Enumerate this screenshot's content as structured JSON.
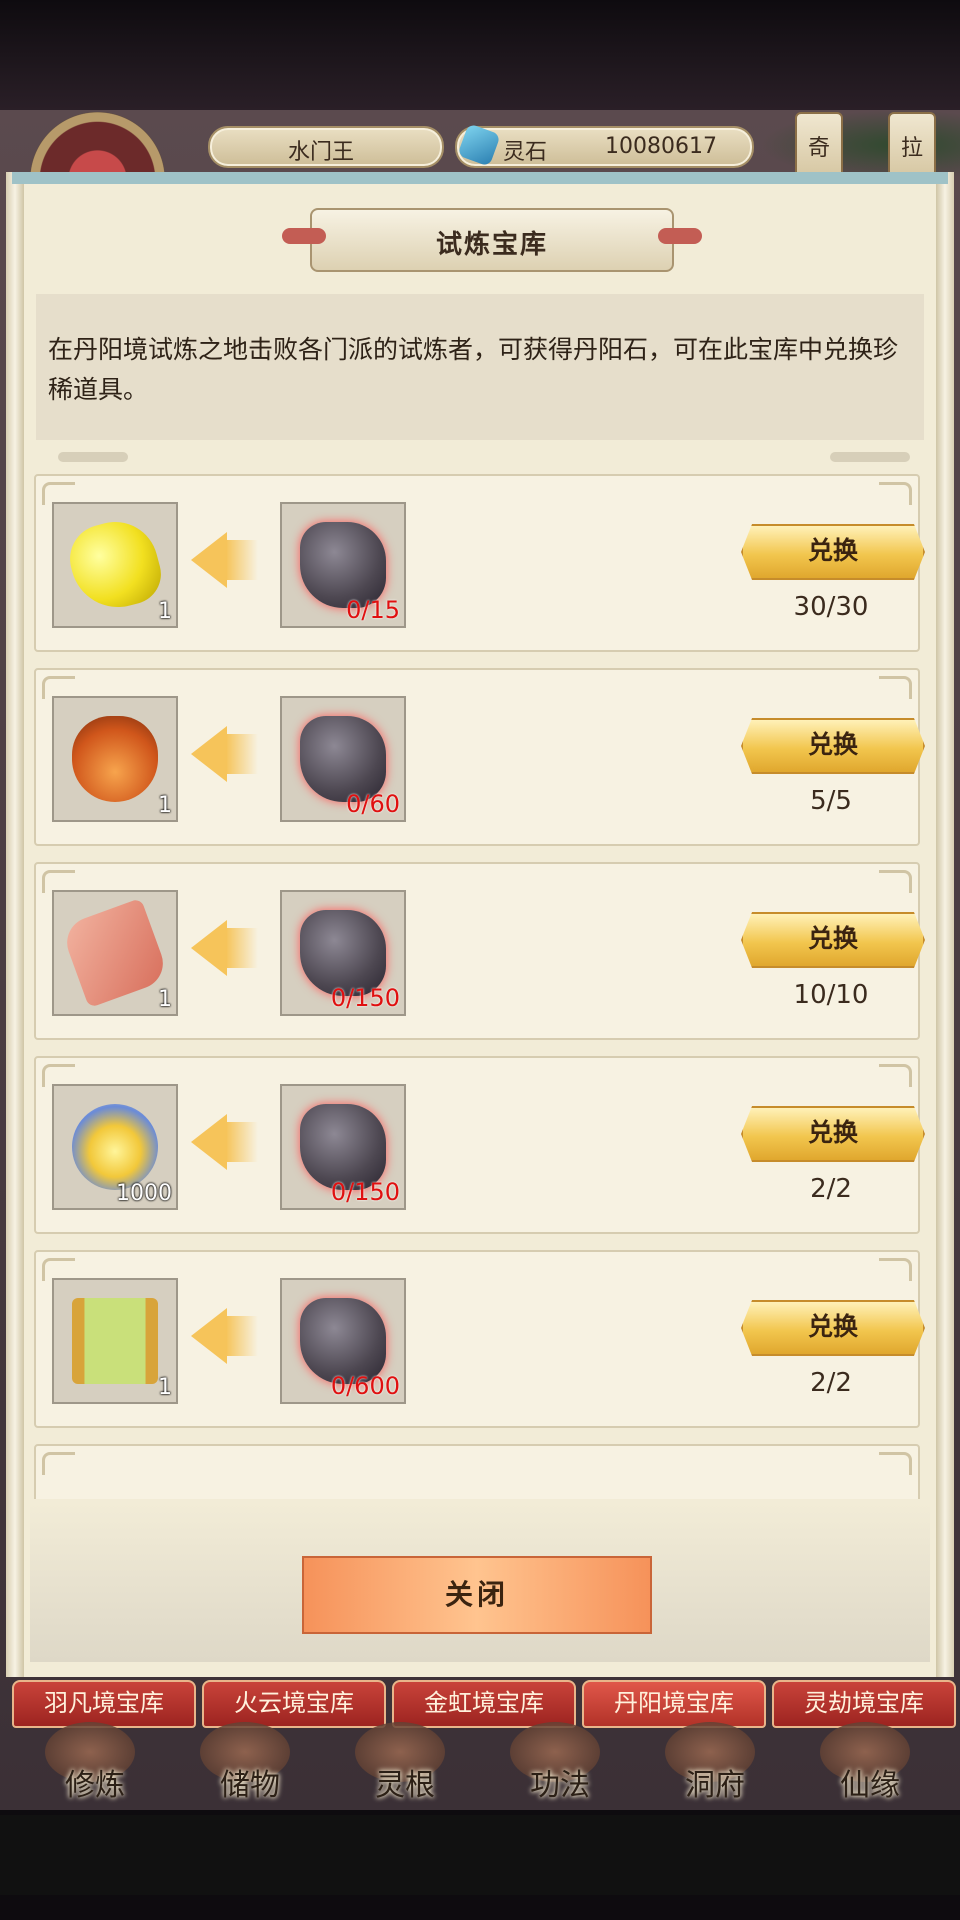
{
  "header": {
    "player_name": "水门王",
    "currency_label": "灵石",
    "currency_value": "10080617",
    "side_badges": [
      "奇",
      "拉"
    ]
  },
  "panel": {
    "title": "试炼宝库",
    "description": "在丹阳境试炼之地击败各门派的试炼者，可获得丹阳石，可在此宝库中兑换珍稀道具。"
  },
  "exchange_items": [
    {
      "reward_icon": "gold-stone-icon",
      "reward_count": "1",
      "cost_icon": "danyang-stone-icon",
      "cost": "0/15",
      "button": "兑换",
      "limit": "30/30"
    },
    {
      "reward_icon": "gourd-icon",
      "reward_count": "1",
      "cost_icon": "danyang-stone-icon",
      "cost": "0/60",
      "button": "兑换",
      "limit": "5/5"
    },
    {
      "reward_icon": "red-scroll-icon",
      "reward_count": "1",
      "cost_icon": "danyang-stone-icon",
      "cost": "0/150",
      "button": "兑换",
      "limit": "10/10"
    },
    {
      "reward_icon": "spirit-flame-icon",
      "reward_count": "1000",
      "cost_icon": "danyang-stone-icon",
      "cost": "0/150",
      "button": "兑换",
      "limit": "2/2"
    },
    {
      "reward_icon": "green-scroll-icon",
      "reward_count": "1",
      "cost_icon": "danyang-stone-icon",
      "cost": "0/600",
      "button": "兑换",
      "limit": "2/2"
    }
  ],
  "close_button": "关闭",
  "tabs": [
    {
      "label": "羽凡境宝库",
      "active": false
    },
    {
      "label": "火云境宝库",
      "active": false
    },
    {
      "label": "金虹境宝库",
      "active": false
    },
    {
      "label": "丹阳境宝库",
      "active": true
    },
    {
      "label": "灵劫境宝库",
      "active": false
    }
  ],
  "main_nav": [
    "修炼",
    "储物",
    "灵根",
    "功法",
    "洞府",
    "仙缘"
  ],
  "colors": {
    "accent_gold": "#f2c64e",
    "cost_red": "#e01010",
    "tab_red": "#b23228",
    "close_orange": "#f6925a"
  }
}
